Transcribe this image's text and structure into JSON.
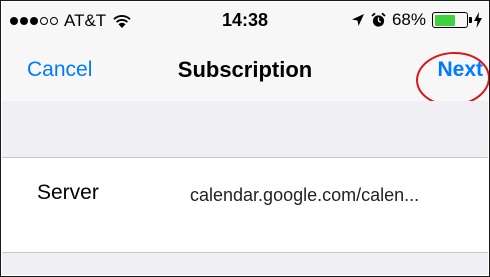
{
  "status_bar": {
    "carrier": "AT&T",
    "signal_bars_filled": 3,
    "signal_bars_total": 5,
    "time": "14:38",
    "battery_percent": "68%",
    "battery_level": 0.68,
    "icons": [
      "signal-dots-icon",
      "wifi-icon",
      "location-arrow-icon",
      "alarm-clock-icon",
      "battery-icon",
      "charging-bolt-icon"
    ]
  },
  "nav": {
    "cancel_label": "Cancel",
    "title": "Subscription",
    "next_label": "Next"
  },
  "form": {
    "rows": [
      {
        "label": "Server",
        "value": "calendar.google.com/calen..."
      }
    ]
  },
  "colors": {
    "accent": "#007aff",
    "highlight_ring": "#d8161b",
    "group_background": "#efeff4",
    "battery": "#3fd23f"
  }
}
